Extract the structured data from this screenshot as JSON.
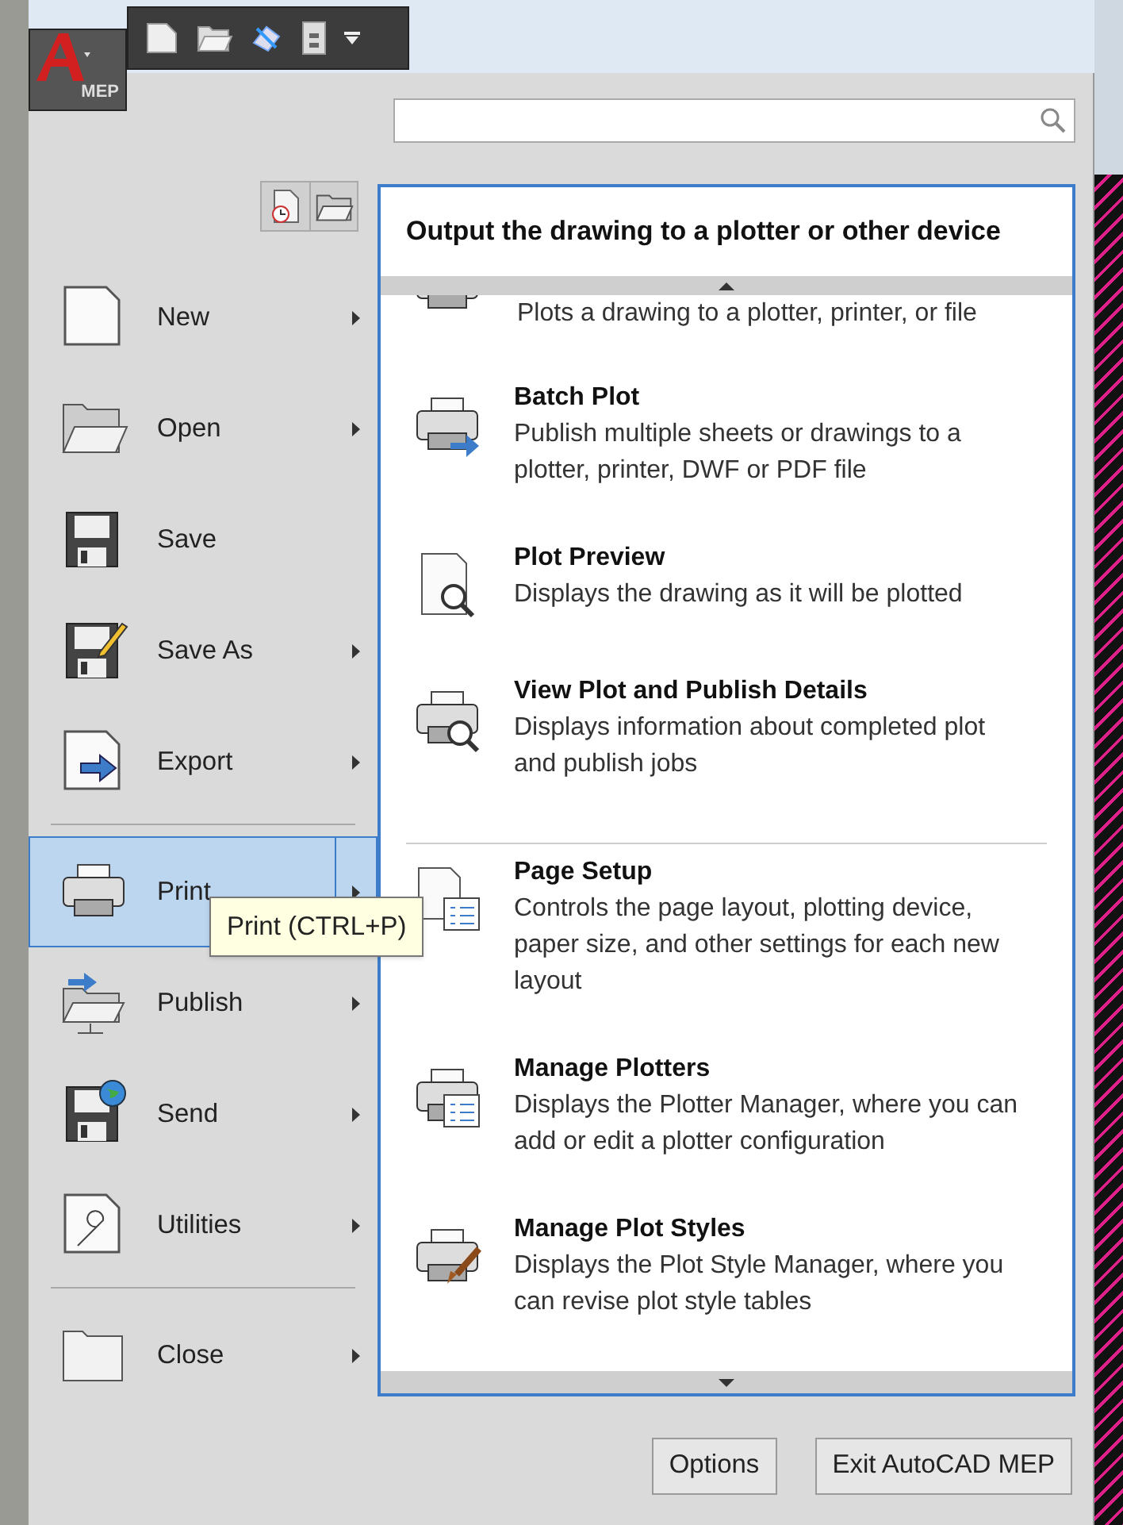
{
  "app_button": {
    "label": "MEP"
  },
  "left_menu": {
    "items": [
      {
        "label": "New",
        "has_submenu": true,
        "selected": false
      },
      {
        "label": "Open",
        "has_submenu": true,
        "selected": false
      },
      {
        "label": "Save",
        "has_submenu": false,
        "selected": false
      },
      {
        "label": "Save As",
        "has_submenu": true,
        "selected": false
      },
      {
        "label": "Export",
        "has_submenu": true,
        "selected": false
      },
      {
        "label": "Print",
        "has_submenu": true,
        "selected": true
      },
      {
        "label": "Publish",
        "has_submenu": true,
        "selected": false
      },
      {
        "label": "Send",
        "has_submenu": true,
        "selected": false
      },
      {
        "label": "Utilities",
        "has_submenu": true,
        "selected": false
      },
      {
        "label": "Close",
        "has_submenu": true,
        "selected": false
      }
    ]
  },
  "tooltip": {
    "text": "Print (CTRL+P)"
  },
  "submenu": {
    "title": "Output the drawing to a plotter or other device",
    "sections": [
      [
        {
          "description": "Plots a drawing to a plotter, printer, or file"
        },
        {
          "title": "Batch Plot",
          "description": "Publish multiple sheets or drawings to a plotter, printer, DWF or PDF file"
        },
        {
          "title": "Plot Preview",
          "description": "Displays the drawing as it will be plotted"
        },
        {
          "title": "View Plot and Publish Details",
          "description": "Displays information about completed plot and publish jobs"
        }
      ],
      [
        {
          "title": "Page Setup",
          "description": "Controls the page layout, plotting device, paper size, and other settings for each new layout"
        },
        {
          "title": "Manage Plotters",
          "description": "Displays the Plotter Manager, where you can add or edit a plotter configuration"
        },
        {
          "title": "Manage Plot Styles",
          "description": "Displays the Plot Style Manager, where you can revise plot style tables"
        }
      ]
    ]
  },
  "buttons": [
    "Options",
    "Exit AutoCAD MEP"
  ]
}
